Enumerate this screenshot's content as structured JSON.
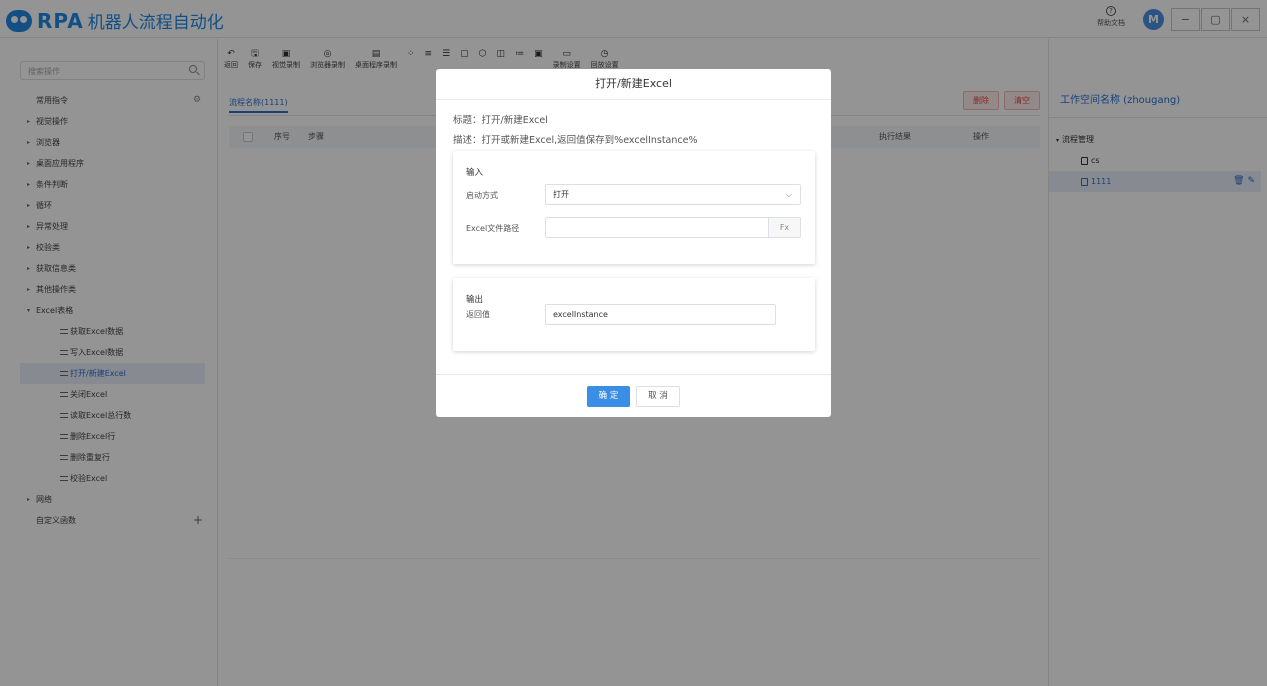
{
  "app": {
    "logo_text": "RPA",
    "title": "机器人流程自动化",
    "help_label": "帮助文档",
    "avatar_letter": "M"
  },
  "window_controls": [
    "−",
    "▢",
    "×"
  ],
  "sidebar": {
    "search_placeholder": "搜索操作",
    "common": "常用指令",
    "categories": [
      "视觉操作",
      "浏览器",
      "桌面应用程序",
      "条件判断",
      "循环",
      "异常处理",
      "校验类",
      "获取信息类",
      "其他操作类"
    ],
    "excel_group": "Excel表格",
    "excel_items": [
      "获取Excel数据",
      "写入Excel数据",
      "打开/新建Excel",
      "关闭Excel",
      "读取Excel总行数",
      "删除Excel行",
      "删除重复行",
      "校验Excel"
    ],
    "network": "网络",
    "custom": "自定义函数"
  },
  "toolbar": [
    {
      "icon": "↶",
      "label": "返回"
    },
    {
      "icon": "🖫",
      "label": "保存"
    },
    {
      "icon": "▣",
      "label": "视觉录制"
    },
    {
      "icon": "◎",
      "label": "浏览器录制"
    },
    {
      "icon": "▤",
      "label": "桌面程序录制"
    },
    {
      "icon": "⁘",
      "label": ""
    },
    {
      "icon": "≡",
      "label": ""
    },
    {
      "icon": "☰",
      "label": ""
    },
    {
      "icon": "▢",
      "label": ""
    },
    {
      "icon": "⬡",
      "label": ""
    },
    {
      "icon": "◫",
      "label": ""
    },
    {
      "icon": "≔",
      "label": ""
    },
    {
      "icon": "▣",
      "label": ""
    },
    {
      "icon": "▭",
      "label": "录制设置"
    },
    {
      "icon": "◷",
      "label": "回放设置"
    }
  ],
  "main": {
    "tab": "流程名称(1111)",
    "delete_btn": "删除",
    "clear_btn": "清空",
    "columns": {
      "index": "序号",
      "step": "步骤",
      "result": "执行结果",
      "action": "操作"
    }
  },
  "right_panel": {
    "title": "工作空间名称 (zhougang)",
    "group": "流程管理",
    "items": [
      "cs",
      "1111"
    ]
  },
  "modal": {
    "title": "打开/新建Excel",
    "subject": "标题：打开/新建Excel",
    "description": "描述：打开或新建Excel,返回值保存到%excelInstance%",
    "input_head": "输入",
    "launch_label": "启动方式",
    "launch_value": "打开",
    "path_label": "Excel文件路径",
    "path_value": "",
    "fx": "Fx",
    "output_head": "输出",
    "return_label": "返回值",
    "return_value": "excelInstance",
    "ok": "确 定",
    "cancel": "取 消"
  },
  "colors": {
    "brand": "#1e88e5",
    "accent": "#3a8ee6",
    "danger": "#e54848"
  }
}
